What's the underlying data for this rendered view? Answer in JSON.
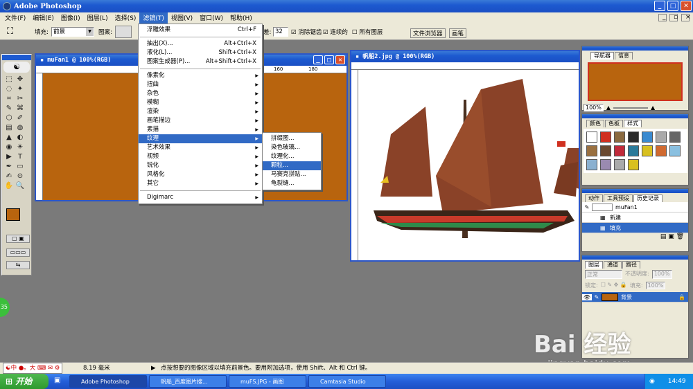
{
  "app": {
    "title": "Adobe Photoshop"
  },
  "menubar": [
    "文件(F)",
    "编辑(E)",
    "图像(I)",
    "图层(L)",
    "选择(S)",
    "滤镜(T)",
    "视图(V)",
    "窗口(W)",
    "帮助(H)"
  ],
  "options": {
    "fill_label": "填充:",
    "fill_value": "前景",
    "pattern_label": "图案:",
    "tolerance_label": "差:",
    "tolerance_value": "32",
    "antialias": "消除锯齿",
    "contiguous": "连续的",
    "all_layers": "所有图层",
    "tab1": "文件浏览器",
    "tab2": "画笔"
  },
  "filter_menu": [
    {
      "label": "浮雕效果",
      "shortcut": "Ctrl+F"
    },
    {
      "sep": true
    },
    {
      "label": "抽出(X)...",
      "shortcut": "Alt+Ctrl+X"
    },
    {
      "label": "液化(L)...",
      "shortcut": "Shift+Ctrl+X"
    },
    {
      "label": "图案生成器(P)...",
      "shortcut": "Alt+Shift+Ctrl+X"
    },
    {
      "sep": true
    },
    {
      "label": "像素化",
      "sub": true
    },
    {
      "label": "扭曲",
      "sub": true
    },
    {
      "label": "杂色",
      "sub": true
    },
    {
      "label": "模糊",
      "sub": true
    },
    {
      "label": "渲染",
      "sub": true
    },
    {
      "label": "画笔描边",
      "sub": true
    },
    {
      "label": "素描",
      "sub": true
    },
    {
      "label": "纹理",
      "sub": true,
      "hl": true
    },
    {
      "label": "艺术效果",
      "sub": true
    },
    {
      "label": "视频",
      "sub": true
    },
    {
      "label": "锐化",
      "sub": true
    },
    {
      "label": "风格化",
      "sub": true
    },
    {
      "label": "其它",
      "sub": true
    },
    {
      "sep": true
    },
    {
      "label": "Digimarc",
      "sub": true
    }
  ],
  "texture_submenu": [
    {
      "label": "拼缀图..."
    },
    {
      "label": "染色玻璃..."
    },
    {
      "label": "纹理化..."
    },
    {
      "label": "颗粒...",
      "hl": true
    },
    {
      "label": "马赛克拼贴..."
    },
    {
      "label": "龟裂缝..."
    }
  ],
  "doc1": {
    "title": "muFan1 @ 100%(RGB)",
    "ruler": [
      "160",
      "180"
    ],
    "fill": "#b8640e"
  },
  "doc2": {
    "title": "帆船2.jpg @ 100%(RGB)"
  },
  "navigator": {
    "tab1": "导航器",
    "tab2": "信息",
    "zoom": "100%"
  },
  "swatches": {
    "tab1": "颜色",
    "tab2": "色板",
    "tab3": "样式"
  },
  "history": {
    "tab1": "动作",
    "tab2": "工具预设",
    "tab3": "历史记录",
    "doc": "muFan1",
    "items": [
      "新建",
      "填充"
    ]
  },
  "layers": {
    "tab1": "图层",
    "tab2": "通道",
    "tab3": "路径",
    "mode": "正常",
    "opacity_label": "不透明度:",
    "opacity": "100%",
    "lock_label": "锁定:",
    "fill_label": "填充:",
    "fill": "100%",
    "layer_name": "背景"
  },
  "status": {
    "size": "8.19 毫米",
    "hint": "点按想要的图像区域以填充前景色。要用附加选项，使用 Shift、Alt 和 Ctrl 键。",
    "ime": "中",
    "ime2": "大"
  },
  "taskbar": {
    "start": "开始",
    "items": [
      "Adobe Photoshop",
      "帆船_百度图片搜...",
      "muFS.JPG - 画图",
      "Camtasia Studio"
    ],
    "time": "14:49"
  },
  "watermark": {
    "text": "Bai 经验",
    "url": "jingyan.baidu.com"
  },
  "colors": {
    "foreground": "#b8640e",
    "accent": "#316ac5"
  }
}
